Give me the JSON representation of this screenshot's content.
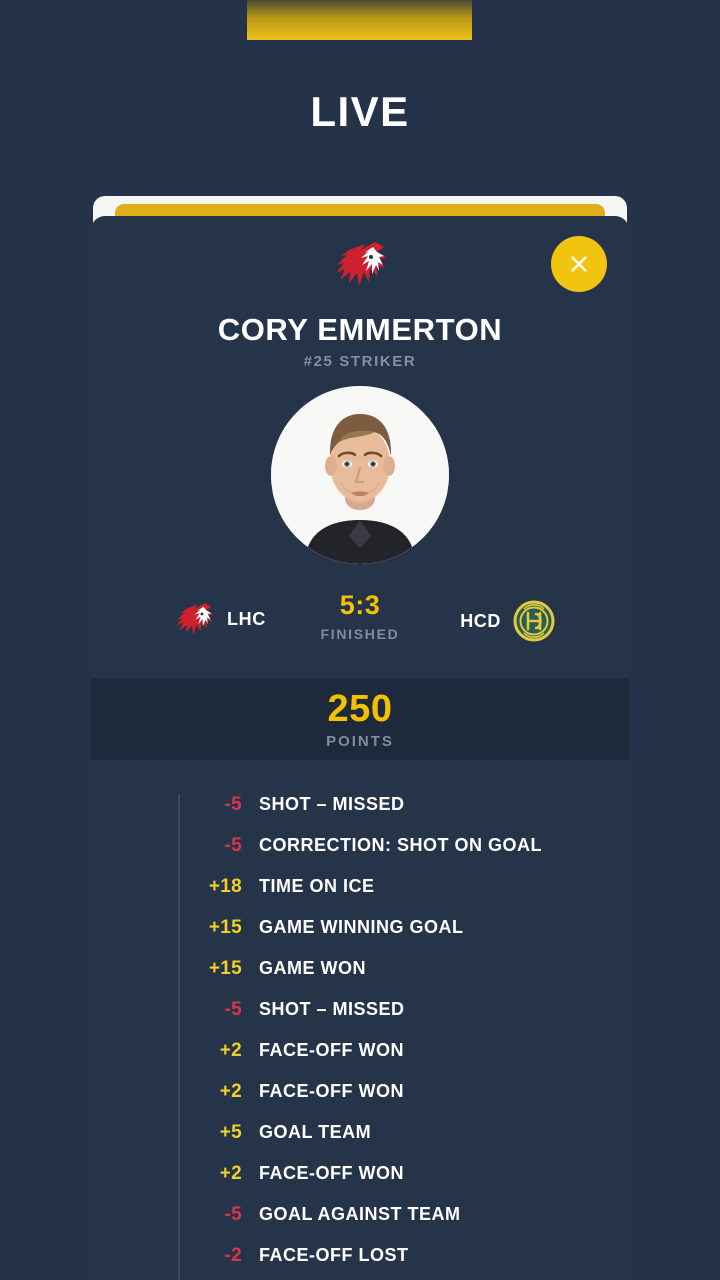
{
  "header": {
    "live_label": "LIVE"
  },
  "colors": {
    "background": "#24334a",
    "card": "#253449",
    "points_band": "#1e2a3c",
    "gold": "#f2c200",
    "positive": "#f2d024",
    "negative": "#d9344a",
    "muted": "#7f8d9d"
  },
  "card": {
    "close_icon": "close-icon",
    "team_crest_icon": "lhc-lion-crest-icon",
    "player": {
      "name": "CORY EMMERTON",
      "number_position": "#25 STRIKER",
      "photo_alt": "player-portrait"
    },
    "match": {
      "home_abbr": "LHC",
      "home_crest_icon": "lhc-lion-crest-icon",
      "away_abbr": "HCD",
      "away_crest_icon": "hcd-badge-icon",
      "score": "5:3",
      "state": "FINISHED"
    },
    "points": {
      "value": "250",
      "label": "POINTS"
    },
    "events": [
      {
        "points": "-5",
        "sign": "neg",
        "label": "SHOT – MISSED"
      },
      {
        "points": "-5",
        "sign": "neg",
        "label": "CORRECTION: SHOT ON GOAL"
      },
      {
        "points": "+18",
        "sign": "pos",
        "label": "TIME ON ICE"
      },
      {
        "points": "+15",
        "sign": "pos",
        "label": "GAME WINNING GOAL"
      },
      {
        "points": "+15",
        "sign": "pos",
        "label": "GAME WON"
      },
      {
        "points": "-5",
        "sign": "neg",
        "label": "SHOT – MISSED"
      },
      {
        "points": "+2",
        "sign": "pos",
        "label": "FACE-OFF WON"
      },
      {
        "points": "+2",
        "sign": "pos",
        "label": "FACE-OFF WON"
      },
      {
        "points": "+5",
        "sign": "pos",
        "label": "GOAL TEAM"
      },
      {
        "points": "+2",
        "sign": "pos",
        "label": "FACE-OFF WON"
      },
      {
        "points": "-5",
        "sign": "neg",
        "label": "GOAL AGAINST TEAM"
      },
      {
        "points": "-2",
        "sign": "neg",
        "label": "FACE-OFF LOST"
      }
    ]
  }
}
